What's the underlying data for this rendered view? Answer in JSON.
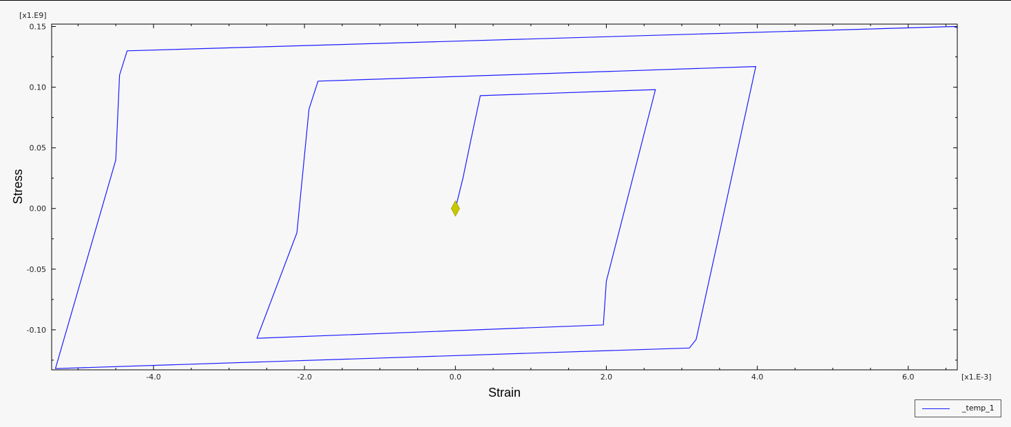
{
  "chart_data": {
    "type": "line",
    "xlabel": "Strain",
    "ylabel": "Stress",
    "x_scale_label": "[x1.E-3]",
    "y_scale_label": "[x1.E9]",
    "xlim": [
      -5.35,
      6.65
    ],
    "ylim": [
      -0.133,
      0.152
    ],
    "x_ticks": [
      -4.0,
      -2.0,
      0.0,
      2.0,
      4.0,
      6.0
    ],
    "x_tick_labels": [
      "-4.0",
      "-2.0",
      "0.0",
      "2.0",
      "4.0",
      "6.0"
    ],
    "y_ticks": [
      -0.1,
      -0.05,
      0.0,
      0.05,
      0.1,
      0.15
    ],
    "y_tick_labels": [
      "-0.10",
      "-0.05",
      "0.00",
      "0.05",
      "0.10",
      "0.15"
    ],
    "grid": false,
    "legend_position": "bottom-right",
    "series": [
      {
        "name": "_temp_1",
        "color": "#1a1aff",
        "points": [
          [
            0.0,
            0.0
          ],
          [
            0.1,
            0.025
          ],
          [
            0.2,
            0.055
          ],
          [
            0.33,
            0.093
          ],
          [
            2.65,
            0.098
          ],
          [
            2.0,
            -0.06
          ],
          [
            1.96,
            -0.096
          ],
          [
            -2.63,
            -0.107
          ],
          [
            -2.1,
            -0.02
          ],
          [
            -1.94,
            0.082
          ],
          [
            -1.82,
            0.105
          ],
          [
            3.98,
            0.117
          ],
          [
            3.5,
            -0.02
          ],
          [
            3.19,
            -0.108
          ],
          [
            3.1,
            -0.115
          ],
          [
            -5.3,
            -0.132
          ],
          [
            -4.5,
            0.04
          ],
          [
            -4.45,
            0.11
          ],
          [
            -4.35,
            0.13
          ],
          [
            6.6,
            0.15
          ],
          [
            6.65,
            0.149
          ]
        ]
      }
    ],
    "marker": {
      "x": 0.0,
      "y": 0.0,
      "color": "#c8c800",
      "shape": "diamond"
    }
  },
  "legend": {
    "label": "_temp_1",
    "color": "#1a1aff"
  }
}
